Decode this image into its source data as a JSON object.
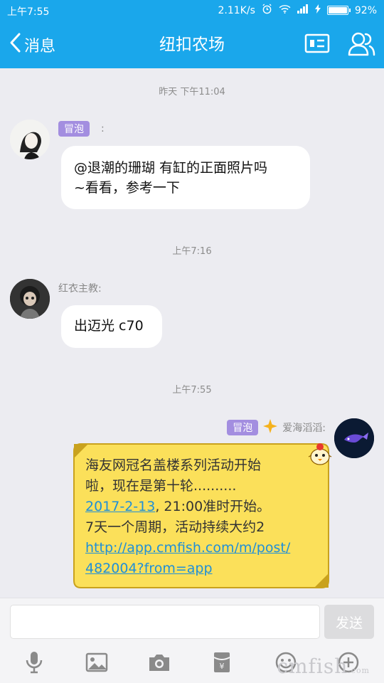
{
  "status_bar": {
    "time": "上午7:55",
    "speed": "2.11K/s",
    "battery": "92%",
    "battery_level": 0.92
  },
  "header": {
    "back_label": "消息",
    "title": "纽扣农场"
  },
  "messages": [
    {
      "timestamp": "昨天 下午11:04",
      "badge": "冒泡",
      "sender": ":",
      "text_line1": "@退潮的珊瑚 有缸的正面照片吗",
      "text_line2": "~看看，参考一下"
    },
    {
      "timestamp": "上午7:16",
      "sender": "红衣主教:",
      "text_line1": "出迈光 c70"
    },
    {
      "timestamp": "上午7:55",
      "badge": "冒泡",
      "sender": "爱海滔滔:",
      "lines": [
        "海友网冠名盖楼系列活动开始",
        "啦，现在是第十轮.........."
      ],
      "date_link": "2017-2-13",
      "after_date": ", 21:00准时开始。",
      "line4": "7天一个周期，活动持续大约2",
      "url_line1": "http://app.cmfish.com/m/post/",
      "url_line2": "482004?from=app"
    }
  ],
  "input": {
    "placeholder": "",
    "send_label": "发送"
  },
  "toolbar": {
    "icons": [
      "microphone-icon",
      "image-icon",
      "camera-icon",
      "red-packet-icon",
      "emoji-icon",
      "plus-icon"
    ]
  },
  "watermark": {
    "text": "cmfish",
    "suffix": ".com"
  },
  "colors": {
    "accent": "#1aa7eb",
    "badge": "#a38ee0",
    "link": "#1f8fd8",
    "bubble_yellow": "#fbe05a"
  }
}
